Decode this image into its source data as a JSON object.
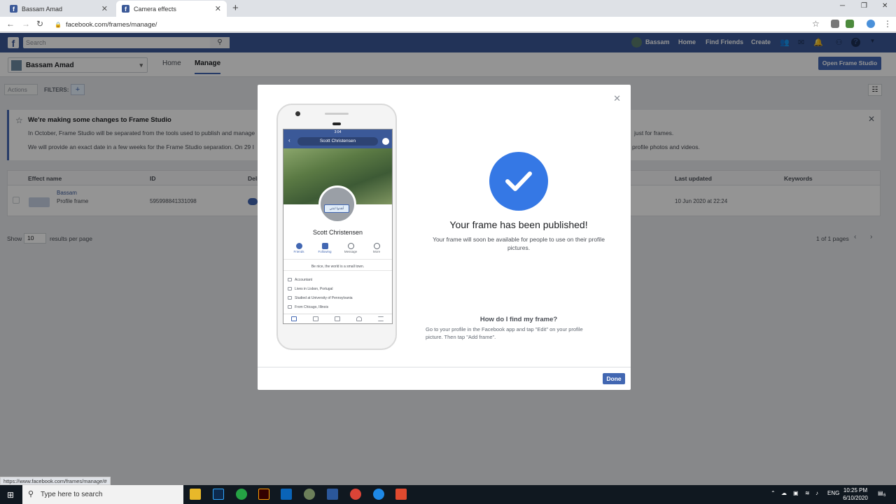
{
  "browser": {
    "tabs": [
      {
        "title": "Bassam Amad",
        "active": false
      },
      {
        "title": "Camera effects",
        "active": true
      }
    ],
    "url": "facebook.com/frames/manage/",
    "status_url": "https://www.facebook.com/frames/manage/#"
  },
  "fb_header": {
    "search_placeholder": "Search",
    "user_name": "Bassam",
    "nav": [
      "Home",
      "Find Friends",
      "Create"
    ]
  },
  "page": {
    "page_name": "Bassam Amad",
    "tabs": [
      "Home",
      "Manage"
    ],
    "active_tab": "Manage",
    "open_frame_studio": "Open Frame Studio",
    "actions_label": "Actions",
    "filters_label": "FILTERS:",
    "notice": {
      "title": "We're making some changes to Frame Studio",
      "line1": "In October, Frame Studio will be separated from the tools used to publish and manage",
      "line1_end": "just for frames.",
      "line2": "We will provide an exact date in a few weeks for the Frame Studio separation. On 29 I",
      "line2_end": "profile photos and videos."
    },
    "table": {
      "headers": [
        "Effect name",
        "ID",
        "Deli",
        "Last updated",
        "Keywords"
      ],
      "rows": [
        {
          "name": "Bassam",
          "type": "Profile frame",
          "id": "595998841331098",
          "updated": "10 Jun 2020 at 22:24"
        }
      ]
    },
    "show_label": "Show",
    "per_page_value": "10",
    "results_label": "results per page",
    "pagination": "1 of 1 pages"
  },
  "modal": {
    "title": "Your frame has been published!",
    "description": "Your frame will soon be available for people to use on their profile pictures.",
    "question": "How do I find my frame?",
    "answer": "Go to your profile in the Facebook app and tap \"Edit\" on your profile picture. Then tap \"Add frame\".",
    "done_label": "Done",
    "phone": {
      "time": "3:04",
      "search_text": "Scott Christensen",
      "profile_name": "Scott Christensen",
      "actions": [
        "Friends",
        "Following",
        "Message",
        "More"
      ],
      "bio": "Be nice, the world is a small town.",
      "info": [
        "Accountant",
        "Lives in Lisbon, Portugal",
        "Studied at University of Pennsylvania",
        "From Chicago, Illinois"
      ],
      "frame_text": "أنقذوا ابنتي"
    }
  },
  "taskbar": {
    "search_placeholder": "Type here to search",
    "lang": "ENG",
    "time": "10:25 PM",
    "date": "6/10/2020",
    "notifications": "6"
  },
  "colors": {
    "fb_blue": "#3b5998",
    "button_blue": "#4267b2",
    "check_blue": "#3578e5"
  }
}
